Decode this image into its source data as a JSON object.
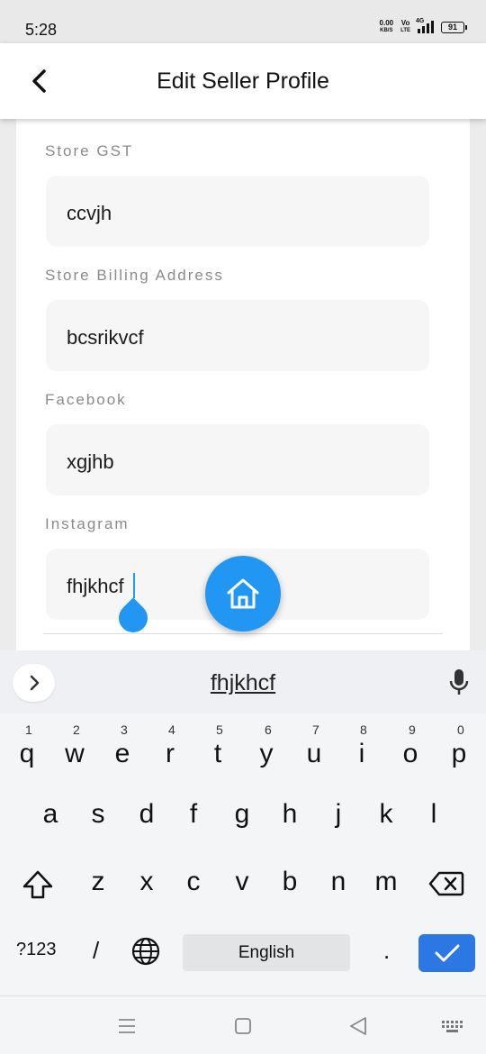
{
  "status_bar": {
    "time": "5:28",
    "net_speed_value": "0.00",
    "net_speed_unit": "KB/S",
    "volte_top": "Vo",
    "volte_bottom": "LTE",
    "network": "4G",
    "battery": "91"
  },
  "header": {
    "title": "Edit Seller Profile",
    "back_icon": "chevron-left-icon"
  },
  "form": {
    "fields": [
      {
        "label": "Store GST",
        "value": "ccvjh"
      },
      {
        "label": "Store Billing Address",
        "value": "bcsrikvcf"
      },
      {
        "label": "Facebook",
        "value": "xgjhb"
      },
      {
        "label": "Instagram",
        "value": "fhjkhcf"
      }
    ]
  },
  "fab": {
    "icon": "home-icon",
    "color": "#2196f3"
  },
  "keyboard": {
    "suggestion": "fhjkhcf",
    "row1": [
      {
        "key": "q",
        "num": "1"
      },
      {
        "key": "w",
        "num": "2"
      },
      {
        "key": "e",
        "num": "3"
      },
      {
        "key": "r",
        "num": "4"
      },
      {
        "key": "t",
        "num": "5"
      },
      {
        "key": "y",
        "num": "6"
      },
      {
        "key": "u",
        "num": "7"
      },
      {
        "key": "i",
        "num": "8"
      },
      {
        "key": "o",
        "num": "9"
      },
      {
        "key": "p",
        "num": "0"
      }
    ],
    "row2": [
      "a",
      "s",
      "d",
      "f",
      "g",
      "h",
      "j",
      "k",
      "l"
    ],
    "row3": [
      "z",
      "x",
      "c",
      "v",
      "b",
      "n",
      "m"
    ],
    "symbols_label": "?123",
    "slash_label": "/",
    "space_label": "English",
    "period_label": ".",
    "enter_color": "#2b78e4"
  },
  "accent_color": "#2196f3"
}
